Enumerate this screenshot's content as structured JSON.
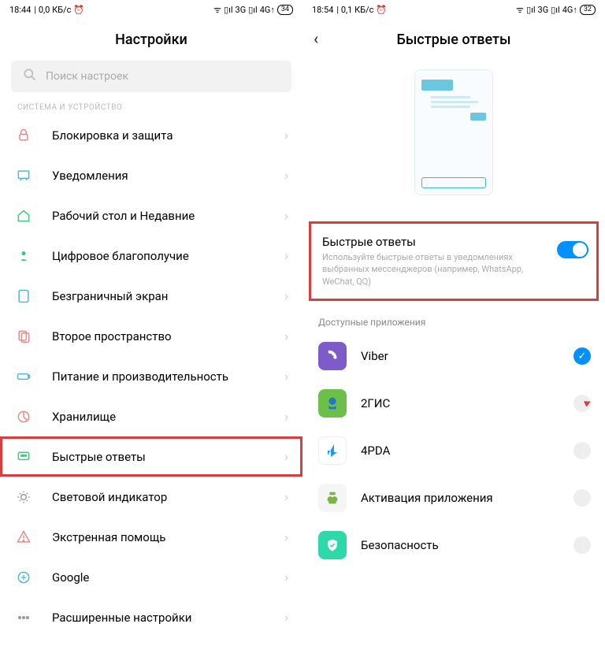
{
  "left": {
    "status": {
      "time": "18:44",
      "net": "0,0 КБ/с",
      "sig1": "3G",
      "sig2": "4G",
      "battery": "34"
    },
    "header": "Настройки",
    "search_placeholder": "Поиск настроек",
    "section": "СИСТЕМА И УСТРОЙСТВО",
    "items": [
      {
        "label": "Блокировка и защита",
        "icon": "lock",
        "color": "#e58a8a"
      },
      {
        "label": "Уведомления",
        "icon": "notify",
        "color": "#4fb8d8"
      },
      {
        "label": "Рабочий стол и Недавние",
        "icon": "home",
        "color": "#3fc97f"
      },
      {
        "label": "Цифровое благополучие",
        "icon": "wellbeing",
        "color": "#2fc97f"
      },
      {
        "label": "Безграничный экран",
        "icon": "fullscreen",
        "color": "#4fb8d8"
      },
      {
        "label": "Второе пространство",
        "icon": "space",
        "color": "#e58a8a"
      },
      {
        "label": "Питание и производительность",
        "icon": "battery",
        "color": "#4fb8d8"
      },
      {
        "label": "Хранилище",
        "icon": "storage",
        "color": "#e58a8a"
      },
      {
        "label": "Быстрые ответы",
        "icon": "reply",
        "color": "#3fc97f",
        "highlight": true
      },
      {
        "label": "Световой индикатор",
        "icon": "light",
        "color": "#999"
      },
      {
        "label": "Экстренная помощь",
        "icon": "sos",
        "color": "#e58a8a"
      },
      {
        "label": "Google",
        "icon": "google",
        "color": "#4fb8d8"
      },
      {
        "label": "Расширенные настройки",
        "icon": "dots",
        "color": "#999"
      }
    ]
  },
  "right": {
    "status": {
      "time": "18:54",
      "net": "0,1 КБ/с",
      "sig1": "3G",
      "sig2": "4G",
      "battery": "32"
    },
    "header": "Быстрые ответы",
    "toggle": {
      "title": "Быстрые ответы",
      "desc": "Используйте быстрые ответы в уведомлениях выбранных мессенджеров (например, WhatsApp, WeChat, QQ)",
      "on": true
    },
    "apps_label": "Доступные приложения",
    "apps": [
      {
        "label": "Viber",
        "bg": "#7d5bc9",
        "checked": true
      },
      {
        "label": "2ГИС",
        "bg": "#6cc04a",
        "checked": false
      },
      {
        "label": "4PDA",
        "bg": "#ffffff",
        "checked": false
      },
      {
        "label": "Активация приложения",
        "bg": "#8bd36a",
        "checked": false
      },
      {
        "label": "Безопасность",
        "bg": "#2fd8a8",
        "checked": false
      }
    ]
  }
}
